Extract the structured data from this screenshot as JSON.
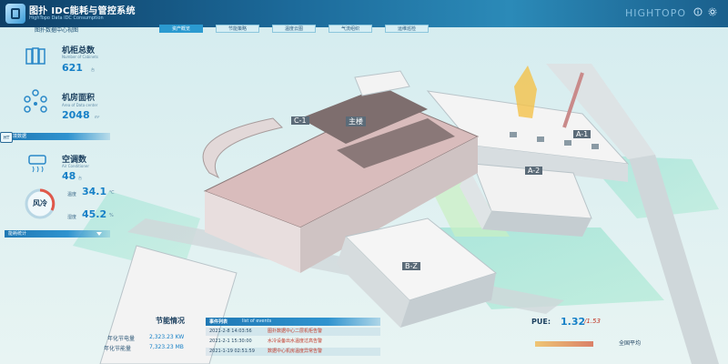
{
  "header": {
    "app_title": "图扑 IDC能耗与管控系统",
    "app_subtitle": "HighTopo Data IDC Consumption",
    "brand": "HIGHTOPO"
  },
  "nav": {
    "view_title": "图扑数据中心视图",
    "tabs": [
      {
        "label": "资产概览",
        "active": true
      },
      {
        "label": "节能策略",
        "active": false
      },
      {
        "label": "温度云图",
        "active": false
      },
      {
        "label": "气流组织",
        "active": false
      },
      {
        "label": "运维巡检",
        "active": false
      }
    ]
  },
  "left_panel": {
    "cabinets": {
      "label": "机柜总数",
      "en": "Number of Cabinets",
      "value": "621",
      "unit": "台"
    },
    "area": {
      "label": "机房面积",
      "en": "Area of Data center",
      "value": "2048",
      "unit": "m²"
    },
    "env_section": "环境数据",
    "ac": {
      "label": "空调数",
      "en": "Air Conditioner",
      "value": "48",
      "unit": "台"
    },
    "cooling": {
      "badge": "风冷",
      "temp_label": "温度",
      "temp_value": "34.1",
      "temp_unit": "℃",
      "humid_label": "湿度",
      "humid_value": "45.2",
      "humid_unit": "%"
    },
    "energy_section": "能耗统计",
    "ht_tab": "HT"
  },
  "energy": {
    "title": "节能情况",
    "rows": [
      {
        "label": "年化节电量",
        "value": "2,323.23 KW"
      },
      {
        "label": "年化节能量",
        "value": "7,323.23 MB"
      }
    ]
  },
  "events": {
    "title": "事件列表",
    "title_en": "list of events",
    "rows": [
      {
        "time": "2021-2-8 14:03:56",
        "desc": "图扑数据中心二层机柜告警"
      },
      {
        "time": "2021-2-1 15:30:00",
        "desc": "水冷设备出水温度过高告警"
      },
      {
        "time": "2021-1-19 02:51:59",
        "desc": "数据中心机房温度异常告警"
      }
    ]
  },
  "pue": {
    "label": "PUE:",
    "value": "1.32",
    "target": "/1.53",
    "overview": "全国平均"
  },
  "buildings": {
    "c1": "C-1",
    "main": "主楼",
    "a1": "A-1",
    "a2": "A-2",
    "b2": "B-Z"
  }
}
